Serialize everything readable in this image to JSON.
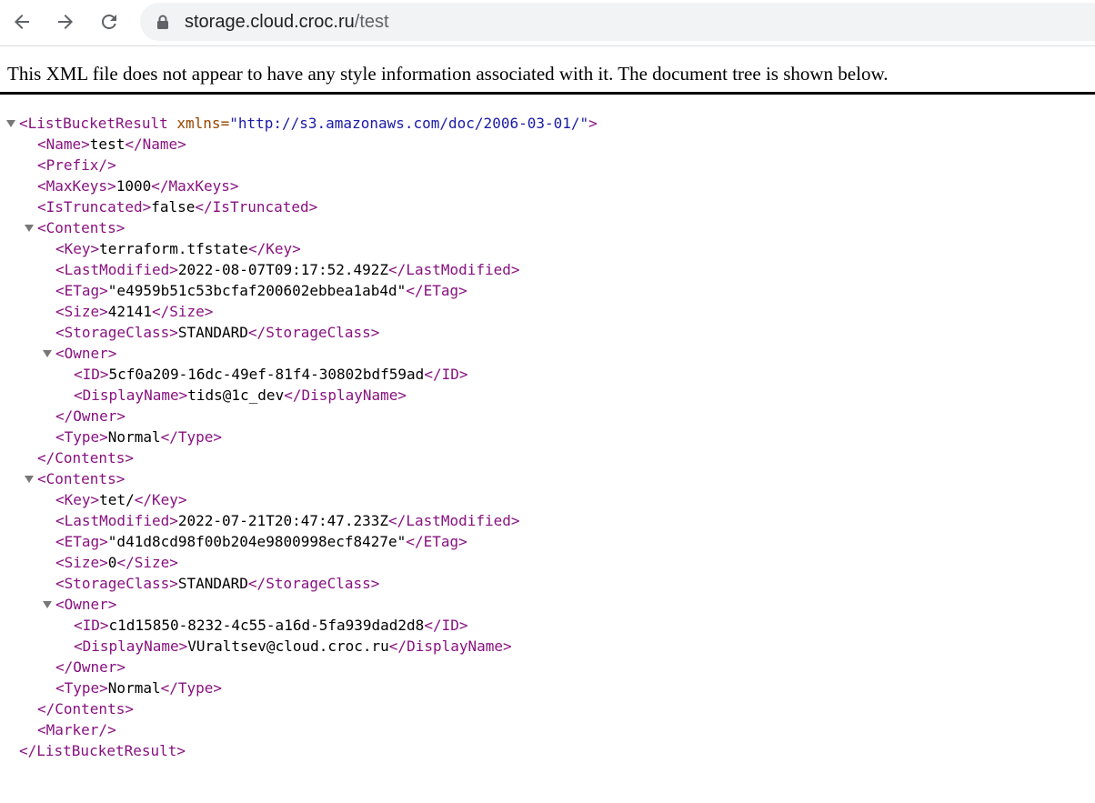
{
  "browser": {
    "url_host": "storage.cloud.croc.ru",
    "url_path": "/test"
  },
  "header": {
    "notice": "This XML file does not appear to have any style information associated with it. The document tree is shown below."
  },
  "xml": {
    "root_open": "<ListBucketResult",
    "root_attr_name": " xmlns=",
    "root_attr_value": "\"http://s3.amazonaws.com/doc/2006-03-01/\"",
    "root_open_end": ">",
    "root_close": "</ListBucketResult>",
    "name": {
      "open": "<Name>",
      "value": "test",
      "close": "</Name>"
    },
    "prefix": "<Prefix/>",
    "max_keys": {
      "open": "<MaxKeys>",
      "value": "1000",
      "close": "</MaxKeys>"
    },
    "is_truncated": {
      "open": "<IsTruncated>",
      "value": "false",
      "close": "</IsTruncated>"
    },
    "marker": "<Marker/>",
    "contents_open": "<Contents>",
    "contents_close": "</Contents>",
    "owner_open": "<Owner>",
    "owner_close": "</Owner>",
    "tags": {
      "key_open": "<Key>",
      "key_close": "</Key>",
      "lm_open": "<LastModified>",
      "lm_close": "</LastModified>",
      "etag_open": "<ETag>",
      "etag_close": "</ETag>",
      "size_open": "<Size>",
      "size_close": "</Size>",
      "sc_open": "<StorageClass>",
      "sc_close": "</StorageClass>",
      "id_open": "<ID>",
      "id_close": "</ID>",
      "dn_open": "<DisplayName>",
      "dn_close": "</DisplayName>",
      "type_open": "<Type>",
      "type_close": "</Type>"
    },
    "contents": [
      {
        "key": "terraform.tfstate",
        "last_modified": "2022-08-07T09:17:52.492Z",
        "etag": "\"e4959b51c53bcfaf200602ebbea1ab4d\"",
        "size": "42141",
        "storage_class": "STANDARD",
        "owner_id": "5cf0a209-16dc-49ef-81f4-30802bdf59ad",
        "owner_display_name": "tids@1c_dev",
        "type": "Normal"
      },
      {
        "key": "tet/",
        "last_modified": "2022-07-21T20:47:47.233Z",
        "etag": "\"d41d8cd98f00b204e9800998ecf8427e\"",
        "size": "0",
        "storage_class": "STANDARD",
        "owner_id": "c1d15850-8232-4c55-a16d-5fa939dad2d8",
        "owner_display_name": "VUraltsev@cloud.croc.ru",
        "type": "Normal"
      }
    ]
  },
  "icons": {
    "back": "arrow-left-icon",
    "forward": "arrow-right-icon",
    "reload": "reload-icon",
    "lock": "lock-icon",
    "collapse": "triangle-down-icon"
  },
  "colors": {
    "tag": "#881280",
    "attr_name": "#994500",
    "attr_value": "#1a1aa6",
    "arrow": "#777777"
  }
}
